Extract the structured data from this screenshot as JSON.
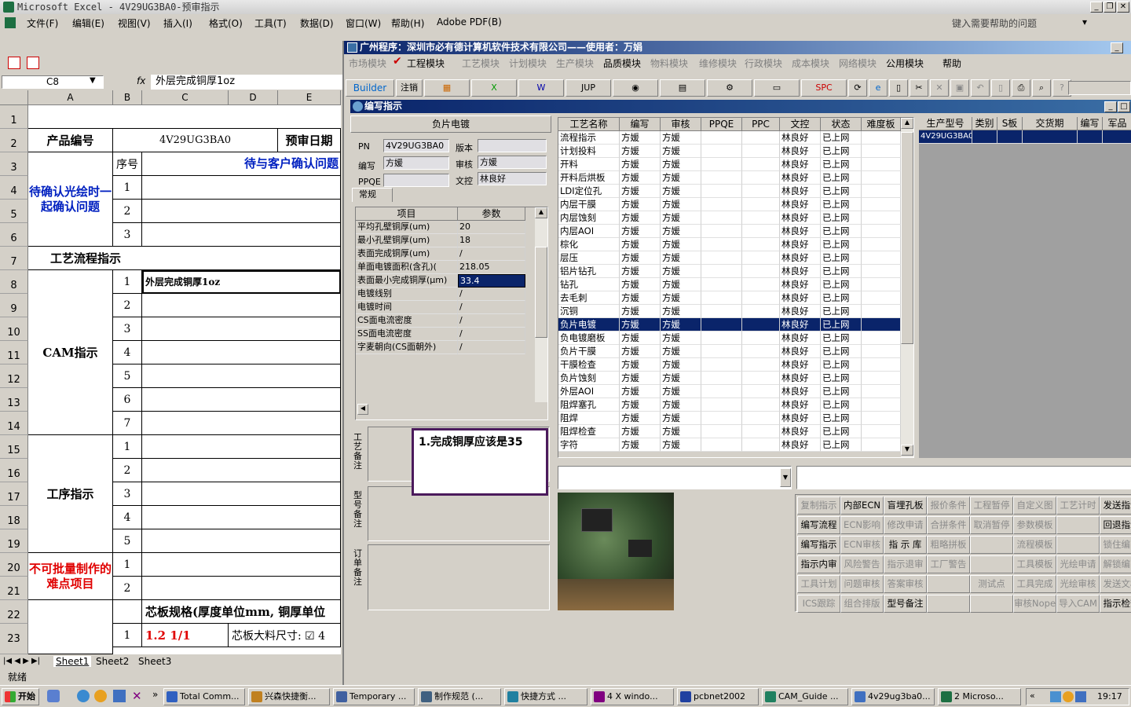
{
  "excel": {
    "title": "Microsoft Excel - 4V29UG3BA0-预审指示",
    "menu": [
      "文件(F)",
      "编辑(E)",
      "视图(V)",
      "插入(I)",
      "格式(O)",
      "工具(T)",
      "数据(D)",
      "窗口(W)",
      "帮助(H)",
      "Adobe PDF(B)"
    ],
    "help_placeholder": "键入需要帮助的问题",
    "namebox": "C8",
    "fx": "fx",
    "formula": "外层完成铜厚1oz",
    "columns": [
      "A",
      "B",
      "C",
      "D",
      "E"
    ],
    "rows": [
      "1",
      "2",
      "3",
      "4",
      "5",
      "6",
      "7",
      "8",
      "9",
      "10",
      "11",
      "12",
      "13",
      "14",
      "15",
      "16",
      "17",
      "18",
      "19",
      "20",
      "21",
      "22",
      "23"
    ],
    "product_label": "产品编号",
    "product_value": "4V29UG3BA0",
    "review_date": "预审日期",
    "seq_header": "序号",
    "confirm_header": "待与客户确认问题",
    "confirm_block": "待确认光绘时一起确认问题",
    "process_title": "工艺流程指示",
    "cam_block": "CAM指示",
    "cam_item1": "外层完成铜厚1oz",
    "proc_block": "工序指示",
    "hard_block": "不可批量制作的难点项目",
    "core_spec": "芯板规格(厚度单位mm, 铜厚单位",
    "core_value": "1.2 1/1",
    "core_size": "芯板大料尺寸: ☑ 4",
    "seq_confirm": [
      "1",
      "2",
      "3"
    ],
    "seq_cam": [
      "1",
      "2",
      "3",
      "4",
      "5",
      "6",
      "7"
    ],
    "seq_proc": [
      "1",
      "2",
      "3",
      "4",
      "5"
    ],
    "seq_hard": [
      "1",
      "2"
    ],
    "seq_core": [
      "1"
    ],
    "sheets": [
      "Sheet1",
      "Sheet2",
      "Sheet3"
    ],
    "status": "就绪"
  },
  "app": {
    "title": "广州程序：深圳市必有德计算机软件技术有限公司——使用者：万娟",
    "menu": [
      {
        "label": "市场模块",
        "on": false
      },
      {
        "label": "工程模块",
        "on": true
      },
      {
        "label": "工艺模块",
        "on": false
      },
      {
        "label": "计划模块",
        "on": false
      },
      {
        "label": "生产模块",
        "on": false
      },
      {
        "label": "品质模块",
        "on": true
      },
      {
        "label": "物料模块",
        "on": false
      },
      {
        "label": "维修模块",
        "on": false
      },
      {
        "label": "行政模块",
        "on": false
      },
      {
        "label": "成本模块",
        "on": false
      },
      {
        "label": "网络模块",
        "on": false
      },
      {
        "label": "公用模块",
        "on": true
      },
      {
        "label": "帮助",
        "on": true
      }
    ],
    "toolbar": {
      "builder": "Builder",
      "logout": "注销",
      "jup": "JUP",
      "spc": "SPC"
    },
    "child_title": "编写指示",
    "step_name": "负片电镀",
    "form": {
      "pn_label": "PN",
      "pn": "4V29UG3BA0",
      "version_label": "版本",
      "version": "",
      "author_label": "编写",
      "author": "方媛",
      "review_label": "审核",
      "review": "方媛",
      "ppqe_label": "PPQE",
      "ppqe": "",
      "control_label": "文控",
      "control": "林良好"
    },
    "tab": "常规",
    "param_headers": [
      "项目",
      "参数"
    ],
    "params": [
      [
        "平均孔壁铜厚(um)",
        "20"
      ],
      [
        "最小孔壁铜厚(um)",
        "18"
      ],
      [
        "表面完成铜厚(um)",
        "/"
      ],
      [
        "单面电镀面积(含孔)(",
        "218.05"
      ],
      [
        "表面最小完成铜厚(μm)",
        "33.4"
      ],
      [
        "电镀线别",
        "/"
      ],
      [
        "电镀时间",
        "/"
      ],
      [
        "CS面电流密度",
        "/"
      ],
      [
        "SS面电流密度",
        "/"
      ],
      [
        "字麦朝向(CS面朝外)",
        "/"
      ]
    ],
    "selected_param": 4,
    "annotation": "1.完成铜厚应该是35",
    "memo_labels": [
      "工艺备注",
      "型号备注",
      "订单备注"
    ],
    "proc_headers": [
      "工艺名称",
      "编写",
      "审核",
      "PPQE",
      "PPC",
      "文控",
      "状态",
      "难度板"
    ],
    "proc_rows": [
      [
        "流程指示",
        "方媛",
        "方媛",
        "",
        "",
        "林良好",
        "已上网",
        ""
      ],
      [
        "计划投料",
        "方媛",
        "方媛",
        "",
        "",
        "林良好",
        "已上网",
        ""
      ],
      [
        "开料",
        "方媛",
        "方媛",
        "",
        "",
        "林良好",
        "已上网",
        ""
      ],
      [
        "开料后烘板",
        "方媛",
        "方媛",
        "",
        "",
        "林良好",
        "已上网",
        ""
      ],
      [
        "LDI定位孔",
        "方媛",
        "方媛",
        "",
        "",
        "林良好",
        "已上网",
        ""
      ],
      [
        "内层干膜",
        "方媛",
        "方媛",
        "",
        "",
        "林良好",
        "已上网",
        ""
      ],
      [
        "内层蚀刻",
        "方媛",
        "方媛",
        "",
        "",
        "林良好",
        "已上网",
        ""
      ],
      [
        "内层AOI",
        "方媛",
        "方媛",
        "",
        "",
        "林良好",
        "已上网",
        ""
      ],
      [
        "棕化",
        "方媛",
        "方媛",
        "",
        "",
        "林良好",
        "已上网",
        ""
      ],
      [
        "层压",
        "方媛",
        "方媛",
        "",
        "",
        "林良好",
        "已上网",
        ""
      ],
      [
        "铝片钻孔",
        "方媛",
        "方媛",
        "",
        "",
        "林良好",
        "已上网",
        ""
      ],
      [
        "钻孔",
        "方媛",
        "方媛",
        "",
        "",
        "林良好",
        "已上网",
        ""
      ],
      [
        "去毛刺",
        "方媛",
        "方媛",
        "",
        "",
        "林良好",
        "已上网",
        ""
      ],
      [
        "沉铜",
        "方媛",
        "方媛",
        "",
        "",
        "林良好",
        "已上网",
        ""
      ],
      [
        "负片电镀",
        "方媛",
        "方媛",
        "",
        "",
        "林良好",
        "已上网",
        ""
      ],
      [
        "负电镀磨板",
        "方媛",
        "方媛",
        "",
        "",
        "林良好",
        "已上网",
        ""
      ],
      [
        "负片干膜",
        "方媛",
        "方媛",
        "",
        "",
        "林良好",
        "已上网",
        ""
      ],
      [
        "干膜检查",
        "方媛",
        "方媛",
        "",
        "",
        "林良好",
        "已上网",
        ""
      ],
      [
        "负片蚀刻",
        "方媛",
        "方媛",
        "",
        "",
        "林良好",
        "已上网",
        ""
      ],
      [
        "外层AOI",
        "方媛",
        "方媛",
        "",
        "",
        "林良好",
        "已上网",
        ""
      ],
      [
        "阻焊塞孔",
        "方媛",
        "方媛",
        "",
        "",
        "林良好",
        "已上网",
        ""
      ],
      [
        "阻焊",
        "方媛",
        "方媛",
        "",
        "",
        "林良好",
        "已上网",
        ""
      ],
      [
        "阻焊检查",
        "方媛",
        "方媛",
        "",
        "",
        "林良好",
        "已上网",
        ""
      ],
      [
        "字符",
        "方媛",
        "方媛",
        "",
        "",
        "林良好",
        "已上网",
        ""
      ]
    ],
    "selected_proc": 14,
    "model_headers": [
      "生产型号",
      "类别",
      "S板",
      "交货期",
      "编写",
      "军品"
    ],
    "model_rows": [
      [
        "4V29UG3BA0",
        "",
        "",
        "",
        "",
        ""
      ]
    ],
    "buttons": [
      [
        {
          "l": "复制指示",
          "d": true
        },
        {
          "l": "内部ECN",
          "d": false
        },
        {
          "l": "盲埋孔板",
          "d": false
        },
        {
          "l": "报价条件",
          "d": true
        },
        {
          "l": "工程暂停",
          "d": true
        },
        {
          "l": "自定义图",
          "d": true
        },
        {
          "l": "工艺计时",
          "d": true
        },
        {
          "l": "发送指示",
          "d": false
        }
      ],
      [
        {
          "l": "编写流程",
          "d": false
        },
        {
          "l": "ECN影响",
          "d": true
        },
        {
          "l": "修改申请",
          "d": true
        },
        {
          "l": "合拼条件",
          "d": true
        },
        {
          "l": "取消暂停",
          "d": true
        },
        {
          "l": "参数模板",
          "d": true
        },
        {
          "l": "",
          "d": true
        },
        {
          "l": "回退指示",
          "d": false
        }
      ],
      [
        {
          "l": "编写指示",
          "d": false
        },
        {
          "l": "ECN审核",
          "d": true
        },
        {
          "l": "指 示 库",
          "d": false
        },
        {
          "l": "粗略拼板",
          "d": true
        },
        {
          "l": "",
          "d": true
        },
        {
          "l": "流程模板",
          "d": true
        },
        {
          "l": "",
          "d": true
        },
        {
          "l": "锁住编写",
          "d": true
        }
      ],
      [
        {
          "l": "指示内审",
          "d": false
        },
        {
          "l": "风险警告",
          "d": true
        },
        {
          "l": "指示退审",
          "d": true
        },
        {
          "l": "工厂警告",
          "d": true
        },
        {
          "l": "",
          "d": true
        },
        {
          "l": "工具模板",
          "d": true
        },
        {
          "l": "光绘申请",
          "d": true
        },
        {
          "l": "解锁编写",
          "d": true
        }
      ],
      [
        {
          "l": "工具计划",
          "d": true
        },
        {
          "l": "问题审核",
          "d": true
        },
        {
          "l": "答案审核",
          "d": true
        },
        {
          "l": "",
          "d": true
        },
        {
          "l": "测试点",
          "d": true
        },
        {
          "l": "工具完成",
          "d": true
        },
        {
          "l": "光绘审核",
          "d": true
        },
        {
          "l": "发送文档",
          "d": true
        }
      ],
      [
        {
          "l": "ICS跟踪",
          "d": true
        },
        {
          "l": "组合排版",
          "d": true
        },
        {
          "l": "型号备注",
          "d": false
        },
        {
          "l": "",
          "d": true
        },
        {
          "l": "",
          "d": true
        },
        {
          "l": "审核Nope",
          "d": true
        },
        {
          "l": "导入CAM",
          "d": true
        },
        {
          "l": "指示检查",
          "d": false
        }
      ]
    ]
  },
  "taskbar": {
    "start": "开始",
    "tasks": [
      "Total Comm...",
      "兴森快捷衡...",
      "Temporary ...",
      "制作规范 (...",
      "快捷方式 ...",
      "4 X windo...",
      "pcbnet2002",
      "CAM_Guide ...",
      "4v29ug3ba0...",
      "2 Microso..."
    ],
    "clock": "19:17"
  }
}
